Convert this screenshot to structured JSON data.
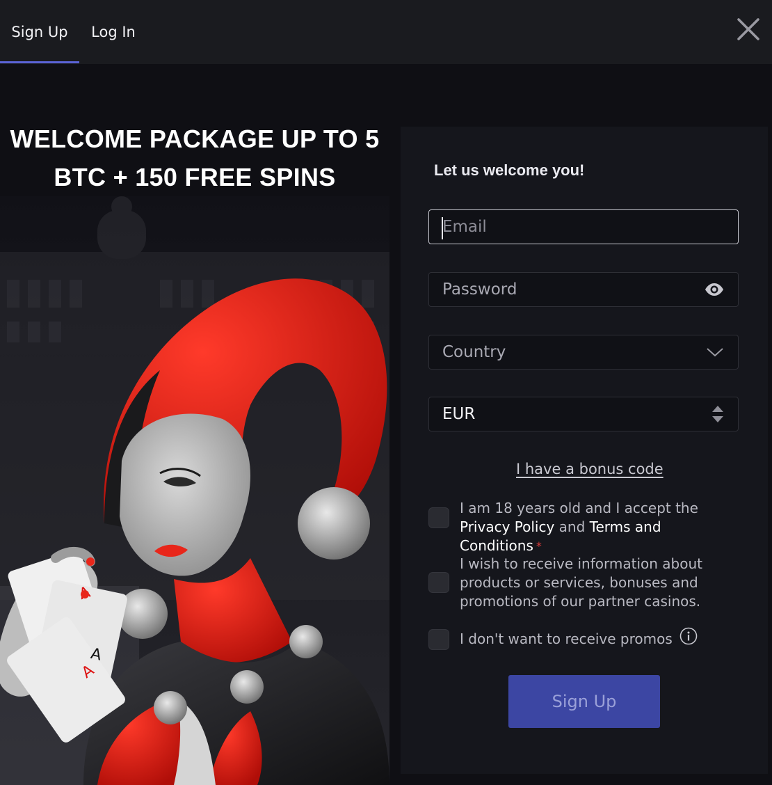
{
  "tabs": {
    "signup": "Sign Up",
    "login": "Log In",
    "active": "signup"
  },
  "promo": {
    "title_line1": "WELCOME PACKAGE UP TO 5",
    "title_line2": "BTC + 150 FREE SPINS"
  },
  "form": {
    "heading": "Let us welcome you!",
    "email_placeholder": "Email",
    "password_placeholder": "Password",
    "country_placeholder": "Country",
    "currency_value": "EUR",
    "bonus_link": "I have a bonus code",
    "consent_age": {
      "text_before": "I am 18 years old and I accept the ",
      "privacy": "Privacy Policy",
      "and": " and ",
      "terms": "Terms and Conditions",
      "required_mark": "*"
    },
    "consent_partners": "I wish to receive information about products or services, bonuses and promotions of our partner casinos.",
    "consent_no_promos": "I don't want to receive promos",
    "submit_label": "Sign Up"
  },
  "colors": {
    "accent_tab": "#5b63d6",
    "button_bg": "#3c46a3",
    "required": "#d63a3a"
  },
  "icons": {
    "close": "close-icon",
    "password_toggle": "eye-icon",
    "country_dropdown": "chevron-down-icon",
    "currency_stepper": "sort-arrows-icon",
    "info": "info-icon"
  }
}
